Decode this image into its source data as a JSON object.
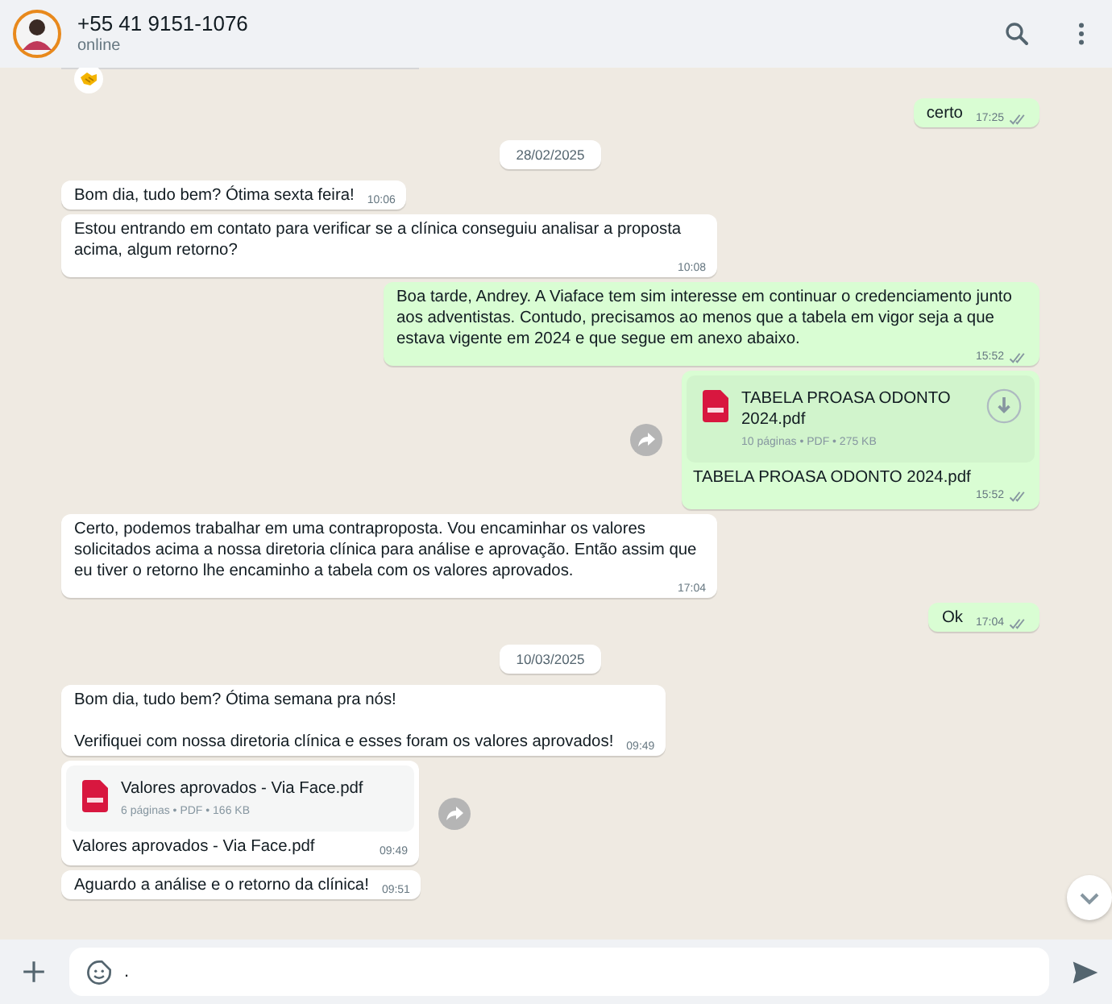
{
  "header": {
    "name": "+55 41 9151-1076",
    "status": "online"
  },
  "top_reaction": {
    "shown": true
  },
  "messages": [
    {
      "kind": "text",
      "outgoing": true,
      "text": "certo",
      "time": "17:25",
      "delivered": true
    },
    {
      "kind": "date",
      "text": "28/02/2025"
    },
    {
      "kind": "text",
      "outgoing": false,
      "text": "Bom dia, tudo bem? Ótima sexta feira!",
      "time": "10:06"
    },
    {
      "kind": "text",
      "outgoing": false,
      "text": "Estou entrando em contato para verificar se a clínica conseguiu analisar a proposta acima, algum retorno?",
      "time": "10:08"
    },
    {
      "kind": "text",
      "outgoing": true,
      "text": "Boa tarde, Andrey. A Viaface tem sim interesse em continuar o credenciamento junto aos adventistas. Contudo, precisamos ao menos que a tabela em vigor seja a que estava vigente em 2024 e que segue em anexo abaixo.",
      "time": "15:52",
      "delivered": true
    },
    {
      "kind": "doc",
      "outgoing": true,
      "title": "TABELA PROASA ODONTO 2024.pdf",
      "meta": "10 páginas • PDF • 275 KB",
      "download": true,
      "caption": "TABELA PROASA ODONTO 2024.pdf",
      "time": "15:52",
      "delivered": true
    },
    {
      "kind": "text",
      "outgoing": false,
      "text": "Certo, podemos trabalhar em uma contraproposta. Vou encaminhar os valores solicitados acima a nossa diretoria clínica para análise e aprovação. Então assim que eu tiver o retorno lhe encaminho a tabela com os valores aprovados.",
      "time": "17:04"
    },
    {
      "kind": "text",
      "outgoing": true,
      "text": "Ok",
      "time": "17:04",
      "delivered": true
    },
    {
      "kind": "date",
      "text": "10/03/2025"
    },
    {
      "kind": "text",
      "outgoing": false,
      "text": "Bom dia, tudo bem? Ótima semana pra nós!\n\nVerifiquei com nossa diretoria clínica e esses foram os valores aprovados!",
      "time": "09:49"
    },
    {
      "kind": "doc",
      "outgoing": false,
      "title": "Valores aprovados - Via Face.pdf",
      "meta": "6 páginas • PDF • 166 KB",
      "download": false,
      "caption": "Valores aprovados - Via Face.pdf",
      "time": "09:49"
    },
    {
      "kind": "text",
      "outgoing": false,
      "text": "Aguardo a análise e o retorno da clínica!",
      "time": "09:51"
    }
  ],
  "composer": {
    "value": "."
  }
}
